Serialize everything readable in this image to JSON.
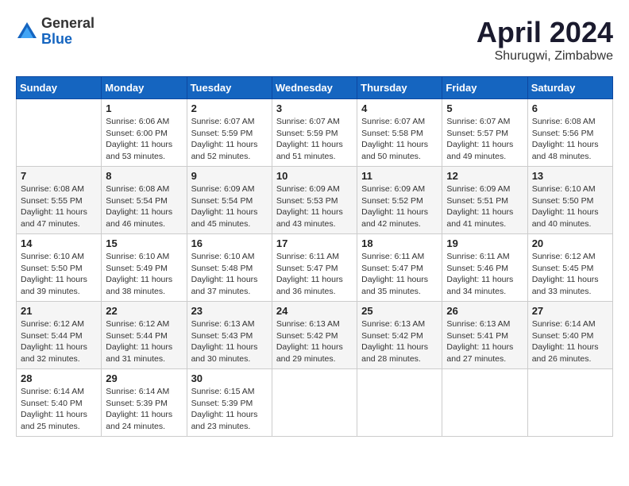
{
  "header": {
    "logo_general": "General",
    "logo_blue": "Blue",
    "month_title": "April 2024",
    "location": "Shurugwi, Zimbabwe"
  },
  "weekdays": [
    "Sunday",
    "Monday",
    "Tuesday",
    "Wednesday",
    "Thursday",
    "Friday",
    "Saturday"
  ],
  "weeks": [
    [
      {
        "day": "",
        "sunrise": "",
        "sunset": "",
        "daylight": ""
      },
      {
        "day": "1",
        "sunrise": "Sunrise: 6:06 AM",
        "sunset": "Sunset: 6:00 PM",
        "daylight": "Daylight: 11 hours and 53 minutes."
      },
      {
        "day": "2",
        "sunrise": "Sunrise: 6:07 AM",
        "sunset": "Sunset: 5:59 PM",
        "daylight": "Daylight: 11 hours and 52 minutes."
      },
      {
        "day": "3",
        "sunrise": "Sunrise: 6:07 AM",
        "sunset": "Sunset: 5:59 PM",
        "daylight": "Daylight: 11 hours and 51 minutes."
      },
      {
        "day": "4",
        "sunrise": "Sunrise: 6:07 AM",
        "sunset": "Sunset: 5:58 PM",
        "daylight": "Daylight: 11 hours and 50 minutes."
      },
      {
        "day": "5",
        "sunrise": "Sunrise: 6:07 AM",
        "sunset": "Sunset: 5:57 PM",
        "daylight": "Daylight: 11 hours and 49 minutes."
      },
      {
        "day": "6",
        "sunrise": "Sunrise: 6:08 AM",
        "sunset": "Sunset: 5:56 PM",
        "daylight": "Daylight: 11 hours and 48 minutes."
      }
    ],
    [
      {
        "day": "7",
        "sunrise": "Sunrise: 6:08 AM",
        "sunset": "Sunset: 5:55 PM",
        "daylight": "Daylight: 11 hours and 47 minutes."
      },
      {
        "day": "8",
        "sunrise": "Sunrise: 6:08 AM",
        "sunset": "Sunset: 5:54 PM",
        "daylight": "Daylight: 11 hours and 46 minutes."
      },
      {
        "day": "9",
        "sunrise": "Sunrise: 6:09 AM",
        "sunset": "Sunset: 5:54 PM",
        "daylight": "Daylight: 11 hours and 45 minutes."
      },
      {
        "day": "10",
        "sunrise": "Sunrise: 6:09 AM",
        "sunset": "Sunset: 5:53 PM",
        "daylight": "Daylight: 11 hours and 43 minutes."
      },
      {
        "day": "11",
        "sunrise": "Sunrise: 6:09 AM",
        "sunset": "Sunset: 5:52 PM",
        "daylight": "Daylight: 11 hours and 42 minutes."
      },
      {
        "day": "12",
        "sunrise": "Sunrise: 6:09 AM",
        "sunset": "Sunset: 5:51 PM",
        "daylight": "Daylight: 11 hours and 41 minutes."
      },
      {
        "day": "13",
        "sunrise": "Sunrise: 6:10 AM",
        "sunset": "Sunset: 5:50 PM",
        "daylight": "Daylight: 11 hours and 40 minutes."
      }
    ],
    [
      {
        "day": "14",
        "sunrise": "Sunrise: 6:10 AM",
        "sunset": "Sunset: 5:50 PM",
        "daylight": "Daylight: 11 hours and 39 minutes."
      },
      {
        "day": "15",
        "sunrise": "Sunrise: 6:10 AM",
        "sunset": "Sunset: 5:49 PM",
        "daylight": "Daylight: 11 hours and 38 minutes."
      },
      {
        "day": "16",
        "sunrise": "Sunrise: 6:10 AM",
        "sunset": "Sunset: 5:48 PM",
        "daylight": "Daylight: 11 hours and 37 minutes."
      },
      {
        "day": "17",
        "sunrise": "Sunrise: 6:11 AM",
        "sunset": "Sunset: 5:47 PM",
        "daylight": "Daylight: 11 hours and 36 minutes."
      },
      {
        "day": "18",
        "sunrise": "Sunrise: 6:11 AM",
        "sunset": "Sunset: 5:47 PM",
        "daylight": "Daylight: 11 hours and 35 minutes."
      },
      {
        "day": "19",
        "sunrise": "Sunrise: 6:11 AM",
        "sunset": "Sunset: 5:46 PM",
        "daylight": "Daylight: 11 hours and 34 minutes."
      },
      {
        "day": "20",
        "sunrise": "Sunrise: 6:12 AM",
        "sunset": "Sunset: 5:45 PM",
        "daylight": "Daylight: 11 hours and 33 minutes."
      }
    ],
    [
      {
        "day": "21",
        "sunrise": "Sunrise: 6:12 AM",
        "sunset": "Sunset: 5:44 PM",
        "daylight": "Daylight: 11 hours and 32 minutes."
      },
      {
        "day": "22",
        "sunrise": "Sunrise: 6:12 AM",
        "sunset": "Sunset: 5:44 PM",
        "daylight": "Daylight: 11 hours and 31 minutes."
      },
      {
        "day": "23",
        "sunrise": "Sunrise: 6:13 AM",
        "sunset": "Sunset: 5:43 PM",
        "daylight": "Daylight: 11 hours and 30 minutes."
      },
      {
        "day": "24",
        "sunrise": "Sunrise: 6:13 AM",
        "sunset": "Sunset: 5:42 PM",
        "daylight": "Daylight: 11 hours and 29 minutes."
      },
      {
        "day": "25",
        "sunrise": "Sunrise: 6:13 AM",
        "sunset": "Sunset: 5:42 PM",
        "daylight": "Daylight: 11 hours and 28 minutes."
      },
      {
        "day": "26",
        "sunrise": "Sunrise: 6:13 AM",
        "sunset": "Sunset: 5:41 PM",
        "daylight": "Daylight: 11 hours and 27 minutes."
      },
      {
        "day": "27",
        "sunrise": "Sunrise: 6:14 AM",
        "sunset": "Sunset: 5:40 PM",
        "daylight": "Daylight: 11 hours and 26 minutes."
      }
    ],
    [
      {
        "day": "28",
        "sunrise": "Sunrise: 6:14 AM",
        "sunset": "Sunset: 5:40 PM",
        "daylight": "Daylight: 11 hours and 25 minutes."
      },
      {
        "day": "29",
        "sunrise": "Sunrise: 6:14 AM",
        "sunset": "Sunset: 5:39 PM",
        "daylight": "Daylight: 11 hours and 24 minutes."
      },
      {
        "day": "30",
        "sunrise": "Sunrise: 6:15 AM",
        "sunset": "Sunset: 5:39 PM",
        "daylight": "Daylight: 11 hours and 23 minutes."
      },
      {
        "day": "",
        "sunrise": "",
        "sunset": "",
        "daylight": ""
      },
      {
        "day": "",
        "sunrise": "",
        "sunset": "",
        "daylight": ""
      },
      {
        "day": "",
        "sunrise": "",
        "sunset": "",
        "daylight": ""
      },
      {
        "day": "",
        "sunrise": "",
        "sunset": "",
        "daylight": ""
      }
    ]
  ]
}
